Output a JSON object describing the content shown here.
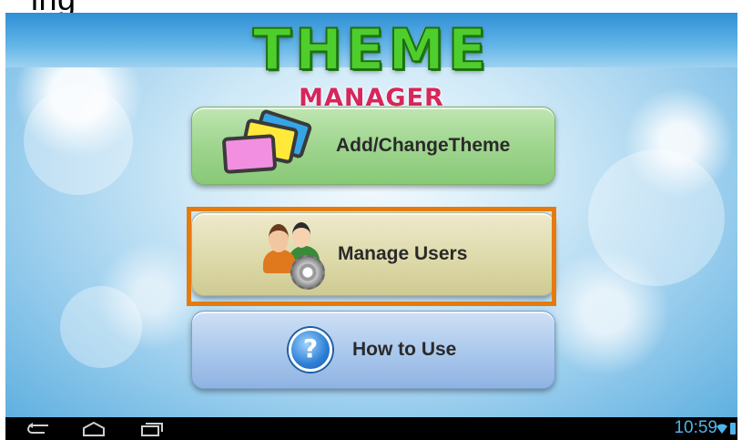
{
  "header": {
    "cropped_text": "ing",
    "title": "THEME",
    "subtitle": "MANAGER"
  },
  "menu": {
    "items": [
      {
        "label": "Add/ChangeTheme",
        "icon": "tablets-icon"
      },
      {
        "label": "Manage Users",
        "icon": "users-gear-icon"
      },
      {
        "label": "How to Use",
        "icon": "help-icon",
        "glyph": "?"
      }
    ]
  },
  "highlight_color": "#e57a10",
  "status_bar": {
    "time": "10:59",
    "icons": [
      "wifi-icon",
      "battery-icon"
    ]
  },
  "nav_bar": {
    "icons": [
      "back-icon",
      "home-icon",
      "recent-apps-icon"
    ]
  }
}
